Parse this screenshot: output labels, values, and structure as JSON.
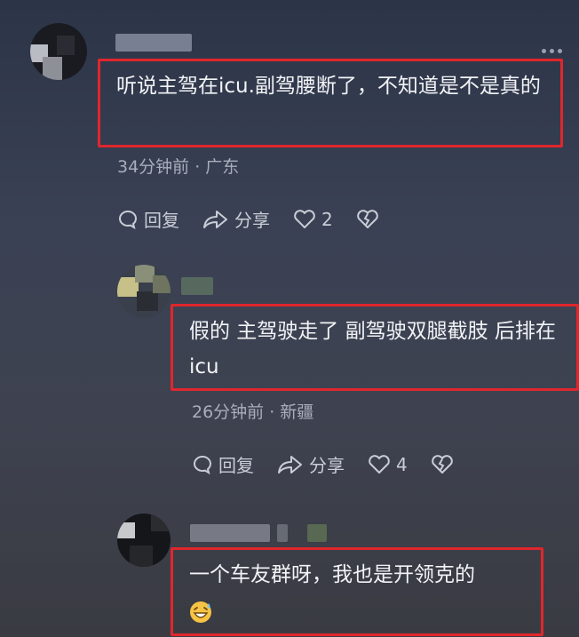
{
  "comments": [
    {
      "text": "听说主驾在icu.副驾腰断了，不知道是不是真的",
      "meta": "34分钟前 · 广东",
      "reply_label": "回复",
      "share_label": "分享",
      "like_count": "2"
    },
    {
      "text": "假的 主驾驶走了 副驾驶双腿截肢 后排在icu",
      "meta": "26分钟前 · 新疆",
      "reply_label": "回复",
      "share_label": "分享",
      "like_count": "4"
    },
    {
      "text": "一个车友群呀，我也是开领克的",
      "emoji": "grinning-sweat-emoji"
    }
  ],
  "colors": {
    "highlight_border": "#e0262d",
    "meta_text": "#a9aebb",
    "bg_top": "#2c3448",
    "bg_bottom": "#3a3b42"
  }
}
